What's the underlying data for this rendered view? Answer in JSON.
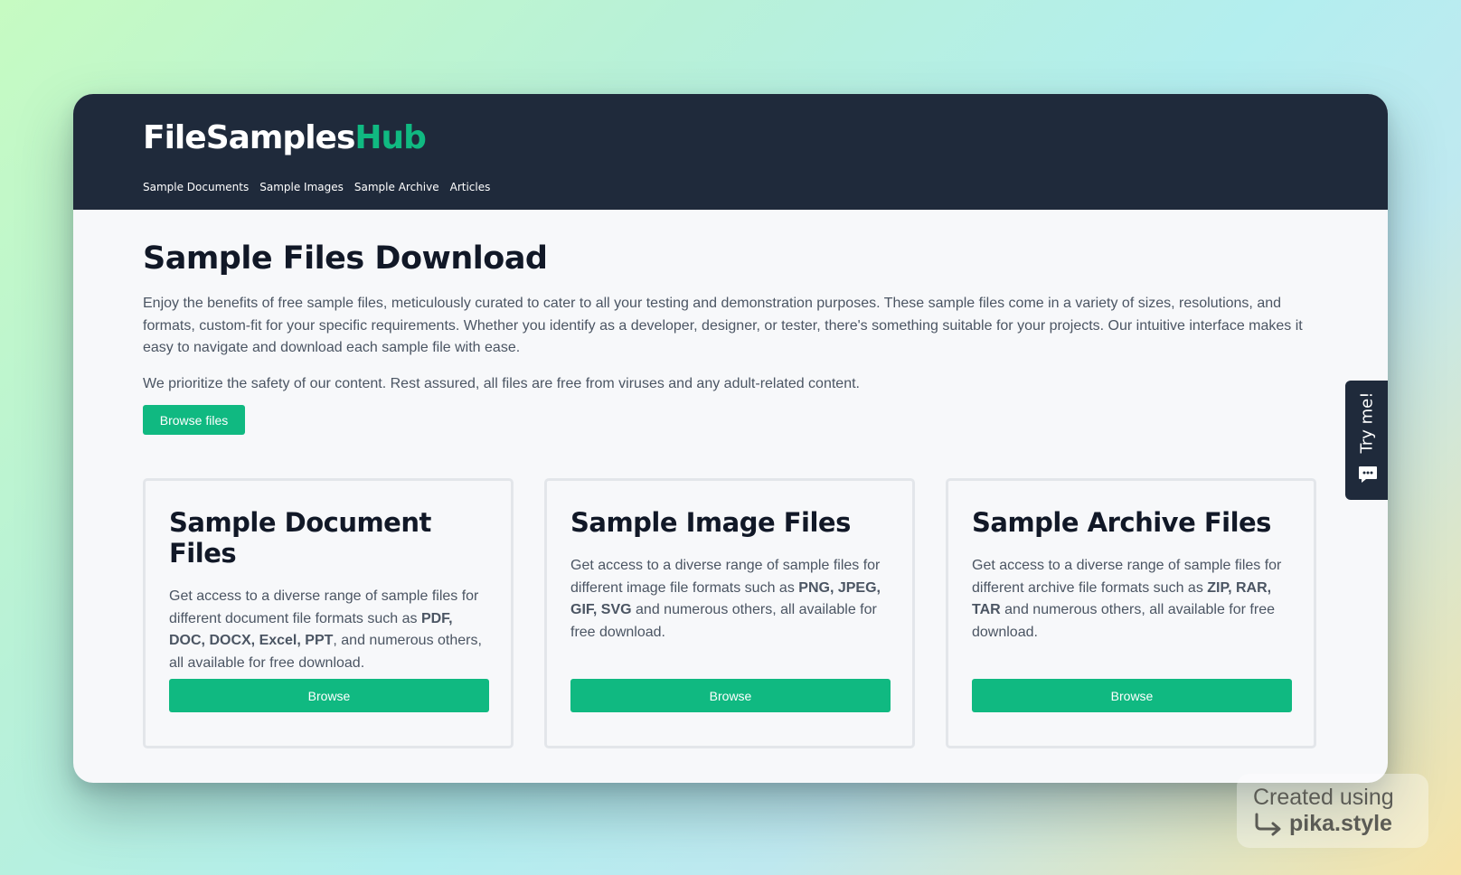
{
  "header": {
    "logo_main": "FileSamples",
    "logo_accent": "Hub",
    "nav": [
      "Sample Documents",
      "Sample Images",
      "Sample Archive",
      "Articles"
    ]
  },
  "main": {
    "title": "Sample Files Download",
    "intro": "Enjoy the benefits of free sample files, meticulously curated to cater to all your testing and demonstration purposes. These sample files come in a variety of sizes, resolutions, and formats, custom-fit for your specific requirements. Whether you identify as a developer, designer, or tester, there's something suitable for your projects. Our intuitive interface makes it easy to navigate and download each sample file with ease.",
    "safety": "We prioritize the safety of our content. Rest assured, all files are free from viruses and any adult-related content.",
    "browse_files_label": "Browse files"
  },
  "cards": [
    {
      "title": "Sample Document Files",
      "text_before": "Get access to a diverse range of sample files for different document file formats such as ",
      "formats": "PDF, DOC, DOCX, Excel, PPT",
      "text_after": ", and numerous others, all available for free download.",
      "button": "Browse"
    },
    {
      "title": "Sample Image Files",
      "text_before": "Get access to a diverse range of sample files for different image file formats such as ",
      "formats": "PNG, JPEG, GIF, SVG",
      "text_after": " and numerous others, all available for free download.",
      "button": "Browse"
    },
    {
      "title": "Sample Archive Files",
      "text_before": "Get access to a diverse range of sample files for different archive file formats such as ",
      "formats": "ZIP, RAR, TAR",
      "text_after": " and numerous others, all available for free download.",
      "button": "Browse"
    }
  ],
  "feedback_tab": {
    "label": "Try me!",
    "icon": "chat-icon"
  },
  "credit": {
    "line1": "Created using",
    "line2": "pika.style"
  },
  "colors": {
    "header_bg": "#1f2a3b",
    "accent": "#10b981",
    "heading": "#111827",
    "body_text": "#4b5563"
  }
}
